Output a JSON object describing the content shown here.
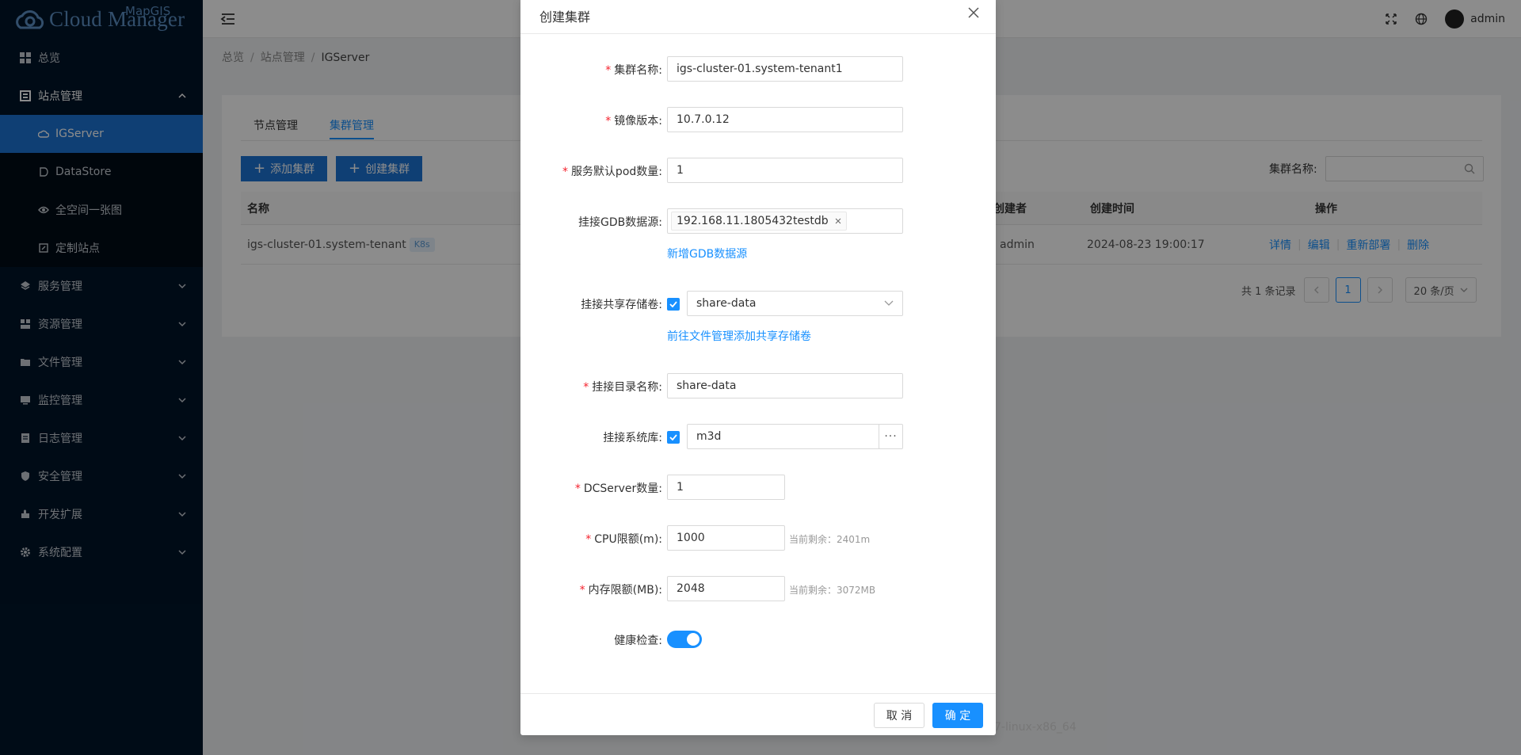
{
  "app": {
    "logo_text": "Cloud Manager",
    "logo_small": "MapGIS"
  },
  "colors": {
    "sidebar_bg": "#001529",
    "accent": "#1890ff",
    "active_menu": "#1c73d3",
    "required": "#f5222d"
  },
  "sidebar": {
    "items": [
      {
        "label": "总览",
        "icon": "dashboard-icon"
      },
      {
        "label": "站点管理",
        "icon": "site-icon",
        "expanded": true,
        "children": [
          {
            "label": "IGServer",
            "icon": "cloud-icon",
            "active": true
          },
          {
            "label": "DataStore",
            "icon": "datastore-icon"
          },
          {
            "label": "全空间一张图",
            "icon": "eye-icon"
          },
          {
            "label": "定制站点",
            "icon": "custom-site-icon"
          }
        ]
      },
      {
        "label": "服务管理",
        "icon": "service-icon"
      },
      {
        "label": "资源管理",
        "icon": "resource-icon"
      },
      {
        "label": "文件管理",
        "icon": "folder-icon"
      },
      {
        "label": "监控管理",
        "icon": "monitor-icon"
      },
      {
        "label": "日志管理",
        "icon": "log-icon"
      },
      {
        "label": "安全管理",
        "icon": "security-icon"
      },
      {
        "label": "开发扩展",
        "icon": "extension-icon"
      },
      {
        "label": "系统配置",
        "icon": "settings-icon"
      }
    ]
  },
  "header": {
    "username": "admin"
  },
  "breadcrumb": [
    "总览",
    "站点管理",
    "IGServer"
  ],
  "tabs": [
    "节点管理",
    "集群管理"
  ],
  "toolbar": {
    "add_cluster": "添加集群",
    "create_cluster": "创建集群",
    "search_label": "集群名称:"
  },
  "table": {
    "columns": {
      "name": "名称",
      "creator": "创建者",
      "created": "创建时间",
      "ops": "操作"
    },
    "row": {
      "name": "igs-cluster-01.system-tenant",
      "tag": "K8s",
      "creator": "admin",
      "created": "2024-08-23 19:00:17",
      "ops": [
        "详情",
        "编辑",
        "重新部署",
        "删除"
      ]
    }
  },
  "pagination": {
    "total": "共 1 条记录",
    "page": "1",
    "page_size": "20 条/页"
  },
  "footer": {
    "version": "7-linux-x86_64"
  },
  "modal": {
    "title": "创建集群",
    "fields": {
      "cluster_name": {
        "label": "集群名称:",
        "value": "igs-cluster-01.system-tenant1"
      },
      "image_version": {
        "label": "镜像版本:",
        "value": "10.7.0.12"
      },
      "pod_count": {
        "label": "服务默认pod数量:",
        "value": "1"
      },
      "gdb_source": {
        "label": "挂接GDB数据源:",
        "tag": "192.168.11.1805432testdb",
        "link": "新增GDB数据源"
      },
      "shared_volume": {
        "label": "挂接共享存储卷:",
        "value": "share-data",
        "link": "前往文件管理添加共享存储卷"
      },
      "mount_dir": {
        "label": "挂接目录名称:",
        "value": "share-data"
      },
      "system_lib": {
        "label": "挂接系统库:",
        "value": "m3d"
      },
      "dcserver_count": {
        "label": "DCServer数量:",
        "value": "1"
      },
      "cpu_limit": {
        "label": "CPU限额(m):",
        "value": "1000",
        "hint": "当前剩余：2401m"
      },
      "mem_limit": {
        "label": "内存限额(MB):",
        "value": "2048",
        "hint": "当前剩余：3072MB"
      },
      "health_check": {
        "label": "健康检查:",
        "enabled": true
      }
    },
    "cancel": "取 消",
    "ok": "确 定"
  }
}
